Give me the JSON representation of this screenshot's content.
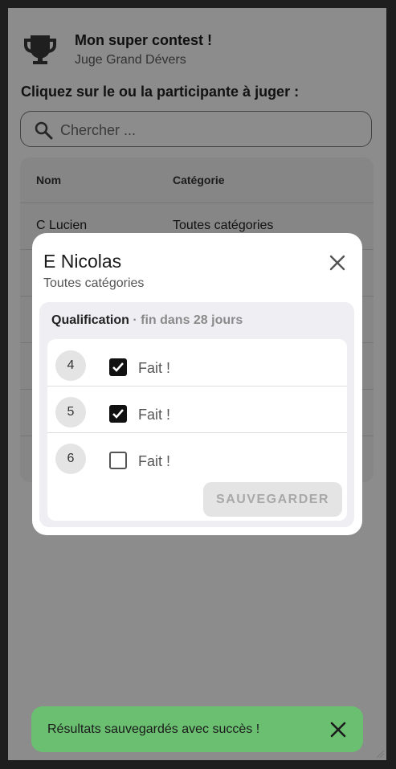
{
  "header": {
    "title": "Mon super contest !",
    "subtitle": "Juge Grand Dévers",
    "icon": "trophy-icon"
  },
  "prompt": "Cliquez sur le ou la participante à juger :",
  "search": {
    "placeholder": "Chercher ...",
    "value": ""
  },
  "table": {
    "columns": [
      "Nom",
      "Catégorie"
    ],
    "rows": [
      {
        "name": "C Lucien",
        "category": "Toutes catégories"
      }
    ]
  },
  "modal": {
    "title": "E Nicolas",
    "subtitle": "Toutes catégories",
    "phase": "Qualification",
    "deadline": " · fin dans 28 jours",
    "items": [
      {
        "number": "4",
        "label": "Fait !",
        "checked": true
      },
      {
        "number": "5",
        "label": "Fait !",
        "checked": true
      },
      {
        "number": "6",
        "label": "Fait !",
        "checked": false
      }
    ],
    "save_label": "SAUVEGARDER"
  },
  "snackbar": {
    "message": "Résultats sauvegardés avec succès !"
  },
  "colors": {
    "snackbar": "#6bbf71",
    "overlay": "rgba(0,0,0,0.45)"
  }
}
